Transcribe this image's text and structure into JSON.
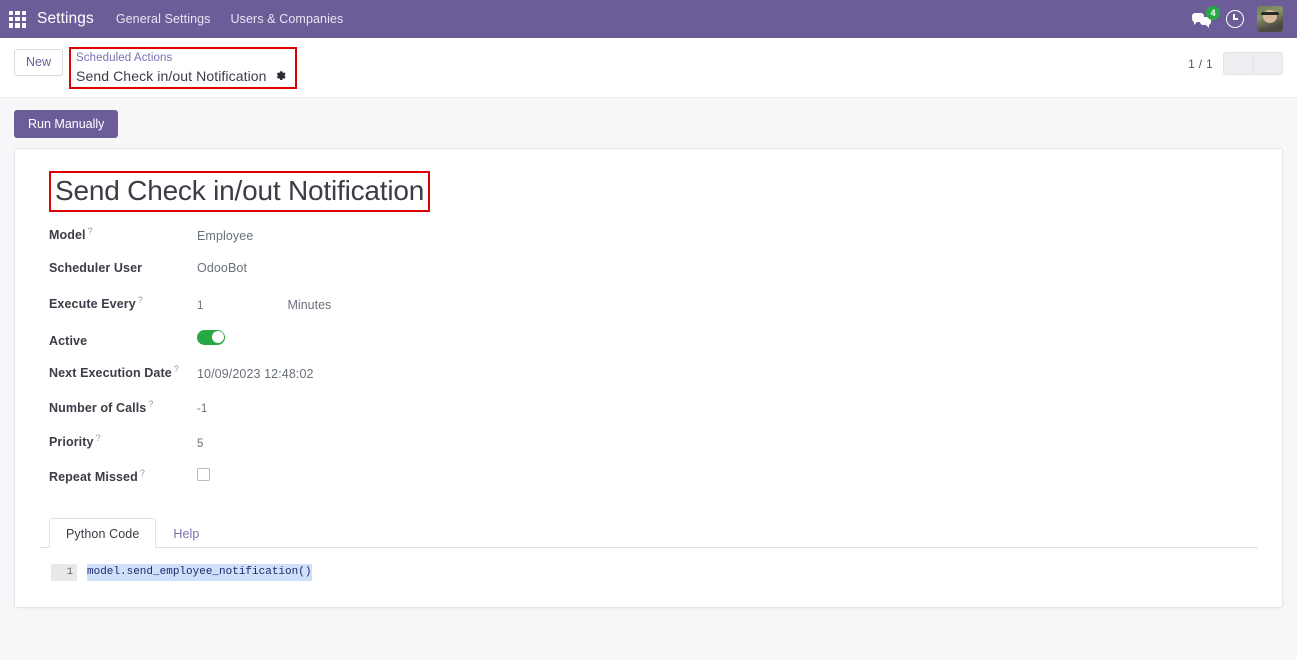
{
  "navbar": {
    "apps_icon": "apps-grid-icon",
    "brand": "Settings",
    "menu_items": [
      {
        "label": "General Settings"
      },
      {
        "label": "Users & Companies"
      }
    ],
    "messages_icon": "messages-icon",
    "messages_badge": "4",
    "activities_icon": "clock-icon",
    "avatar_icon": "user-avatar",
    "bg_color": "#6c5d99"
  },
  "control_panel": {
    "new_label": "New",
    "breadcrumb": {
      "parent": "Scheduled Actions",
      "current": "Send Check in/out Notification",
      "settings_icon": "gear-icon",
      "highlight_color": "#e00000"
    },
    "pager": {
      "value": "1 / 1",
      "previous_icon": "chevron-left-icon",
      "next_icon": "chevron-right-icon"
    }
  },
  "action_bar": {
    "run_manually_label": "Run Manually",
    "button_color": "#6c5d99"
  },
  "record": {
    "title": "Send Check in/out Notification",
    "title_highlight_color": "#e00000",
    "fields": [
      {
        "label": "Model",
        "help": "?",
        "value": "Employee",
        "type": "text"
      },
      {
        "label": "Scheduler User",
        "help": "",
        "value": "OdooBot",
        "type": "text"
      },
      {
        "label": "Execute Every",
        "help": "?",
        "value": "1",
        "unit": "Minutes",
        "type": "number_unit"
      },
      {
        "label": "Active",
        "help": "",
        "value": "on",
        "type": "toggle"
      },
      {
        "label": "Next Execution Date",
        "help": "?",
        "value": "10/09/2023 12:48:02",
        "type": "text"
      },
      {
        "label": "Number of Calls",
        "help": "?",
        "value": "-1",
        "type": "text"
      },
      {
        "label": "Priority",
        "help": "?",
        "value": "5",
        "type": "text"
      },
      {
        "label": "Repeat Missed",
        "help": "?",
        "value": "off",
        "type": "checkbox"
      }
    ],
    "notebook": {
      "tabs": [
        {
          "label": "Python Code",
          "active": true
        },
        {
          "label": "Help",
          "active": false
        }
      ],
      "code": {
        "line_number": "1",
        "text": "model.send_employee_notification()"
      }
    }
  }
}
